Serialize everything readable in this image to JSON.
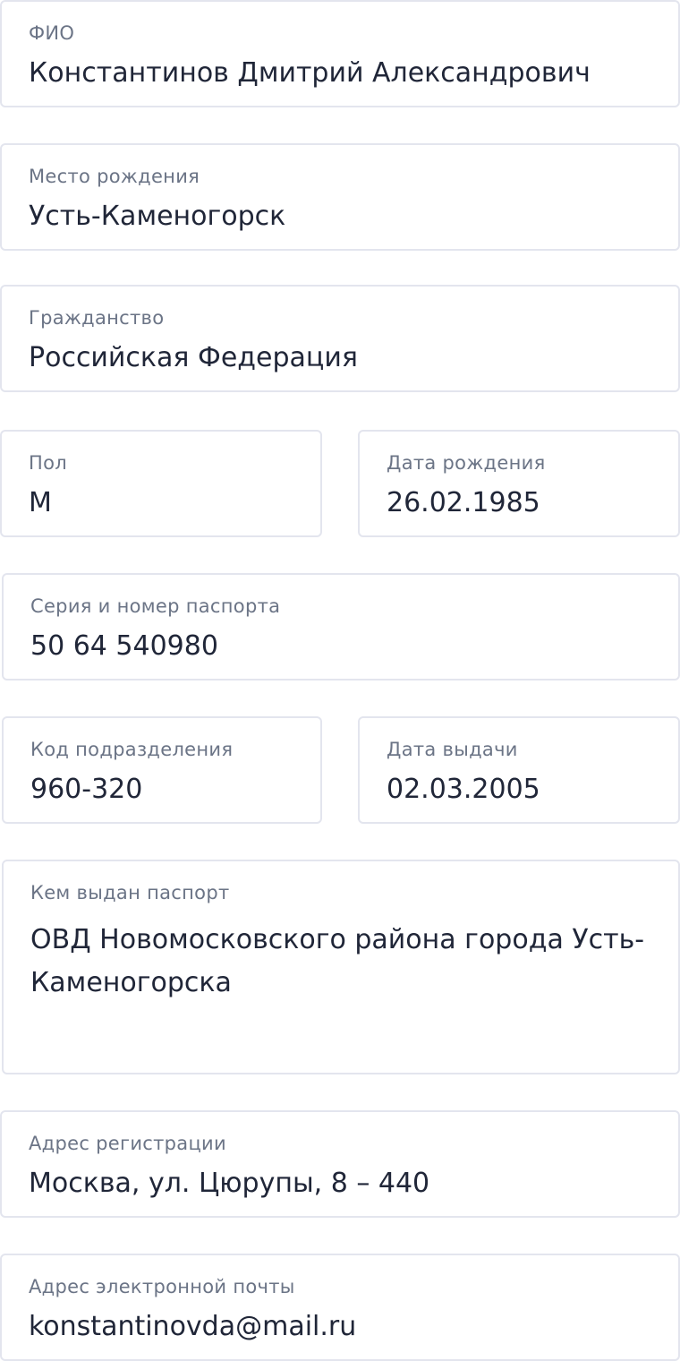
{
  "form": {
    "full_name": {
      "label": "ФИО",
      "value": "Константинов Дмитрий Александрович"
    },
    "birth_place": {
      "label": "Место рождения",
      "value": "Усть-Каменогорск"
    },
    "citizenship": {
      "label": "Гражданство",
      "value": "Российская Федерация"
    },
    "sex": {
      "label": "Пол",
      "value": "М"
    },
    "birth_date": {
      "label": "Дата рождения",
      "value": "26.02.1985"
    },
    "passport": {
      "label": "Серия и номер паспорта",
      "value": "50 64 540980"
    },
    "division_code": {
      "label": "Код подразделения",
      "value": "960-320"
    },
    "issue_date": {
      "label": "Дата выдачи",
      "value": "02.03.2005"
    },
    "issued_by": {
      "label": "Кем выдан паспорт",
      "value": "ОВД Новомосковского района города Усть-Каменогорска"
    },
    "reg_address": {
      "label": "Адрес регистрации",
      "value": "Москва, ул. Цюрупы, 8 – 440"
    },
    "email": {
      "label": "Адрес электронной почты",
      "value": "konstantinovda@mail.ru"
    }
  }
}
